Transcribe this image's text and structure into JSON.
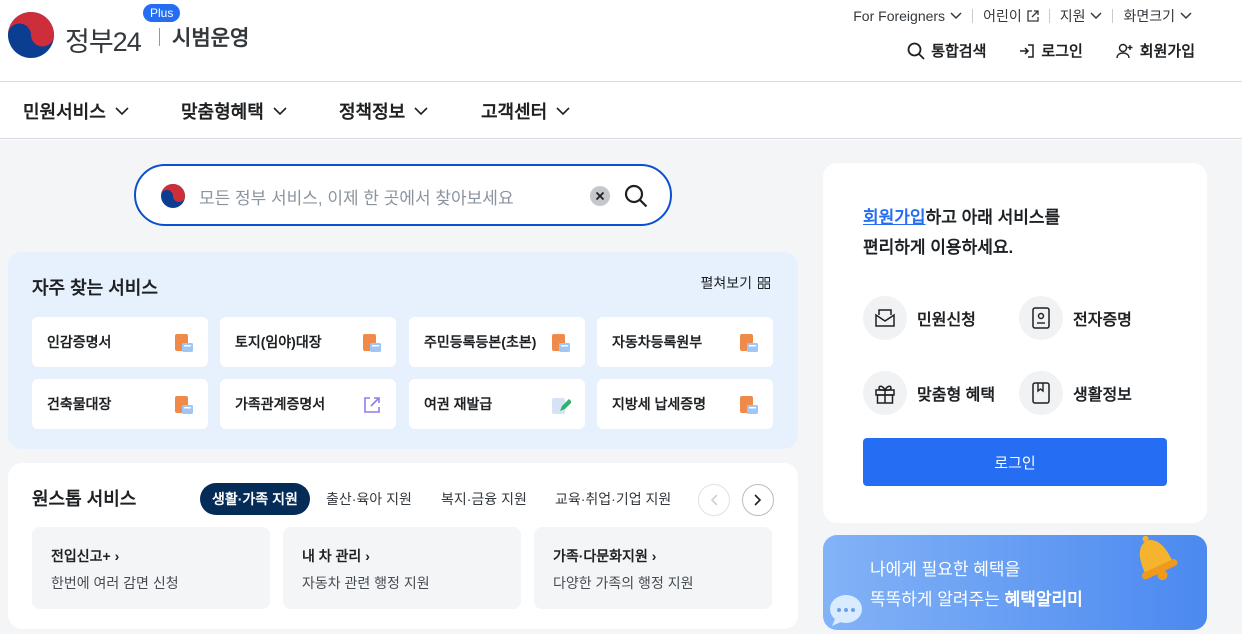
{
  "header": {
    "brand": "정부24",
    "plus_badge": "Plus",
    "trial_label": "시범운영",
    "util_links": [
      "For Foreigners",
      "어린이",
      "지원",
      "화면크기"
    ],
    "account_links": [
      "통합검색",
      "로그인",
      "회원가입"
    ]
  },
  "nav": {
    "items": [
      "민원서비스",
      "맞춤형혜택",
      "정책정보",
      "고객센터"
    ]
  },
  "search": {
    "placeholder": "모든 정부 서비스, 이제 한 곳에서 찾아보세요"
  },
  "frequent": {
    "title": "자주 찾는 서비스",
    "expand_label": "펼쳐보기",
    "cards": [
      {
        "label": "인감증명서",
        "icon": "document-print-icon"
      },
      {
        "label": "토지(임야)대장",
        "icon": "document-print-icon"
      },
      {
        "label": "주민등록등본(초본)",
        "icon": "document-print-icon"
      },
      {
        "label": "자동차등록원부",
        "icon": "document-print-icon"
      },
      {
        "label": "건축물대장",
        "icon": "document-print-icon"
      },
      {
        "label": "가족관계증명서",
        "icon": "external-link-icon"
      },
      {
        "label": "여권 재발급",
        "icon": "edit-form-icon"
      },
      {
        "label": "지방세 납세증명",
        "icon": "document-print-icon"
      }
    ]
  },
  "onestop": {
    "title": "원스톱 서비스",
    "tabs": [
      "생활·가족 지원",
      "출산·육아 지원",
      "복지·금융 지원",
      "교육·취업·기업 지원"
    ],
    "active_tab": "생활·가족 지원",
    "cards": [
      {
        "title": "전입신고+",
        "desc": "한번에 여러 감면 신청"
      },
      {
        "title": "내 차 관리",
        "desc": "자동차 관련 행정 지원"
      },
      {
        "title": "가족·다문화지원",
        "desc": "다양한 가족의 행정 지원"
      }
    ]
  },
  "side": {
    "signup_link": "회원가입",
    "msg_line1_rest": "하고 아래 서비스를",
    "msg_line2": "편리하게 이용하세요.",
    "quick": [
      "민원신청",
      "전자증명",
      "맞춤형 혜택",
      "생활정보"
    ],
    "login_button": "로그인"
  },
  "banner": {
    "line1": "나에게 필요한 혜택을",
    "line2_prefix": "똑똑하게 알려주는 ",
    "line2_bold": "혜택알리미"
  },
  "colors": {
    "primary": "#256ef4",
    "active_tab": "#052b57",
    "search_border": "#0b50d0",
    "frequent_bg": "#e7f1fd"
  }
}
